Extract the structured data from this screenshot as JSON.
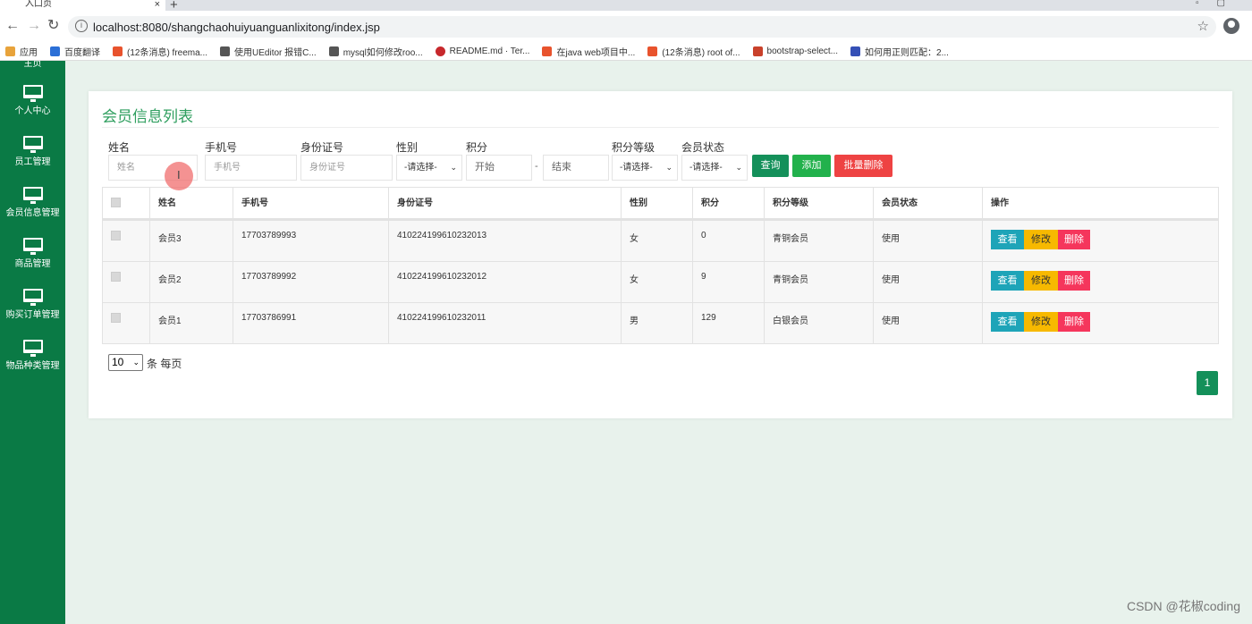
{
  "browser": {
    "tab_title": "入口页",
    "tab_close": "×",
    "new_tab": "+",
    "url": "localhost:8080/shangchaohuiyuanguanlixitong/index.jsp",
    "bookmarks": [
      {
        "label": "应用",
        "color": "#e8a33b"
      },
      {
        "label": "百度翻译",
        "color": "#2b6fd6"
      },
      {
        "label": "(12条消息) freema...",
        "color": "#e8532d"
      },
      {
        "label": "使用UEditor 报错C...",
        "color": "#555555"
      },
      {
        "label": "mysql如何修改roo...",
        "color": "#555555"
      },
      {
        "label": "README.md · Ter...",
        "color": "#c7282c"
      },
      {
        "label": "在java web项目中...",
        "color": "#e8532d"
      },
      {
        "label": "(12条消息) root of...",
        "color": "#e8532d"
      },
      {
        "label": "bootstrap-select...",
        "color": "#c9412b"
      },
      {
        "label": "如何用正则匹配：2...",
        "color": "#3550b6"
      }
    ]
  },
  "sidebar": {
    "items": [
      {
        "label": "主页"
      },
      {
        "label": "个人中心"
      },
      {
        "label": "员工管理"
      },
      {
        "label": "会员信息管理"
      },
      {
        "label": "商品管理"
      },
      {
        "label": "购买订单管理"
      },
      {
        "label": "物品种类管理"
      }
    ]
  },
  "page": {
    "title": "会员信息列表",
    "filters": {
      "name_label": "姓名",
      "name_placeholder": "姓名",
      "phone_label": "手机号",
      "phone_placeholder": "手机号",
      "id_label": "身份证号",
      "id_placeholder": "身份证号",
      "gender_label": "性别",
      "gender_value": "-请选择-",
      "points_label": "积分",
      "points_start": "开始",
      "points_sep": "-",
      "points_end": "结束",
      "level_label": "积分等级",
      "level_value": "-请选择-",
      "status_label": "会员状态",
      "status_value": "-请选择-"
    },
    "buttons": {
      "query": "查询",
      "add": "添加",
      "batch_delete": "批量删除"
    },
    "table": {
      "headers": [
        "姓名",
        "手机号",
        "身份证号",
        "性别",
        "积分",
        "积分等级",
        "会员状态",
        "操作"
      ],
      "rows": [
        {
          "name": "会员3",
          "phone": "17703789993",
          "id_card": "410224199610232013",
          "gender": "女",
          "points": "0",
          "level": "青铜会员",
          "status": "使用"
        },
        {
          "name": "会员2",
          "phone": "17703789992",
          "id_card": "410224199610232012",
          "gender": "女",
          "points": "9",
          "level": "青铜会员",
          "status": "使用"
        },
        {
          "name": "会员1",
          "phone": "17703786991",
          "id_card": "410224199610232011",
          "gender": "男",
          "points": "129",
          "level": "白银会员",
          "status": "使用"
        }
      ],
      "actions": {
        "view": "查看",
        "edit": "修改",
        "delete": "删除"
      }
    },
    "pagination": {
      "page_size": "10",
      "per_page_text": "条 每页",
      "current_page": "1"
    }
  },
  "watermark": "CSDN @花椒coding",
  "colors": {
    "sidebar": "#0a7a45",
    "title": "#2e9e5e",
    "query": "#14905a",
    "add": "#22b14c",
    "batch_delete": "#ee4343",
    "view": "#1ea4b8",
    "edit": "#f7b900",
    "delete": "#f5365c"
  }
}
